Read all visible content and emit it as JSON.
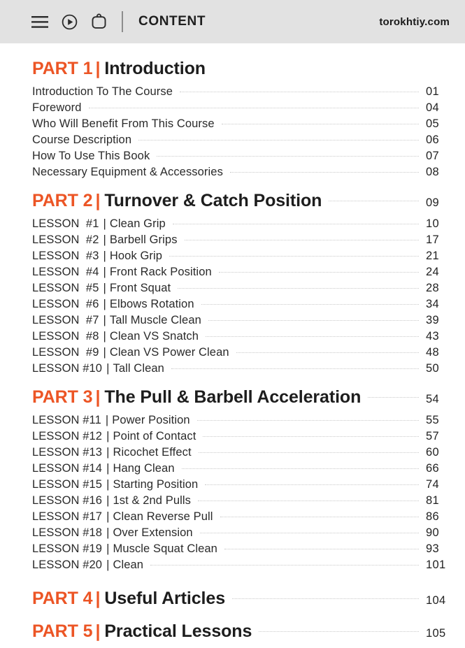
{
  "header": {
    "icons": [
      {
        "name": "hamburger-menu-icon",
        "label": "menu"
      },
      {
        "name": "play-circle-icon",
        "label": "play"
      },
      {
        "name": "bag-icon",
        "label": "bag"
      }
    ],
    "title": "CONTENT",
    "brand": "torokhtiy.com"
  },
  "colors": {
    "accent": "#ec5525",
    "header_bg": "#e2e2e2",
    "text": "#2a2a2a",
    "leader": "#c9c9c9"
  },
  "parts": [
    {
      "kw": "PART 1",
      "bar": "|",
      "title": "Introduction",
      "page": "",
      "entries": [
        {
          "label": "Introduction To The Course",
          "page": "01"
        },
        {
          "label": "Foreword",
          "page": "04"
        },
        {
          "label": "Who Will Benefit From This Course",
          "page": "05"
        },
        {
          "label": "Course Description",
          "page": "06"
        },
        {
          "label": "How To Use This Book",
          "page": "07"
        },
        {
          "label": "Necessary Equipment & Accessories",
          "page": "08"
        }
      ]
    },
    {
      "kw": "PART 2",
      "bar": "|",
      "title": "Turnover & Catch Position",
      "page": "09",
      "lessons": [
        {
          "word": "LESSON",
          "num": "#1",
          "pipe": "|",
          "title": "Clean Grip",
          "page": "10"
        },
        {
          "word": "LESSON",
          "num": "#2",
          "pipe": "|",
          "title": "Barbell Grips",
          "page": "17"
        },
        {
          "word": "LESSON",
          "num": "#3",
          "pipe": "|",
          "title": "Hook Grip",
          "page": "21"
        },
        {
          "word": "LESSON",
          "num": "#4",
          "pipe": "|",
          "title": "Front Rack Position",
          "page": "24"
        },
        {
          "word": "LESSON",
          "num": "#5",
          "pipe": "|",
          "title": "Front Squat",
          "page": "28"
        },
        {
          "word": "LESSON",
          "num": "#6",
          "pipe": "|",
          "title": "Elbows Rotation",
          "page": "34"
        },
        {
          "word": "LESSON",
          "num": "#7",
          "pipe": "|",
          "title": "Tall Muscle Clean",
          "page": "39"
        },
        {
          "word": "LESSON",
          "num": "#8",
          "pipe": "|",
          "title": "Clean VS Snatch",
          "page": "43"
        },
        {
          "word": "LESSON",
          "num": "#9",
          "pipe": "|",
          "title": "Clean VS Power Clean",
          "page": "48"
        },
        {
          "word": "LESSON",
          "num": "#10",
          "pipe": "|",
          "title": "Tall Clean",
          "page": "50"
        }
      ]
    },
    {
      "kw": "PART 3",
      "bar": "|",
      "title": "The Pull & Barbell Acceleration",
      "page": "54",
      "lessons": [
        {
          "word": "LESSON",
          "num": "#11",
          "pipe": "|",
          "title": "Power Position",
          "page": "55"
        },
        {
          "word": "LESSON",
          "num": "#12",
          "pipe": "|",
          "title": "Point of Contact",
          "page": "57"
        },
        {
          "word": "LESSON",
          "num": "#13",
          "pipe": "|",
          "title": "Ricochet Effect",
          "page": "60"
        },
        {
          "word": "LESSON",
          "num": "#14",
          "pipe": "|",
          "title": "Hang Clean",
          "page": "66"
        },
        {
          "word": "LESSON",
          "num": "#15",
          "pipe": "|",
          "title": "Starting Position",
          "page": "74"
        },
        {
          "word": "LESSON",
          "num": "#16",
          "pipe": "|",
          "title": "1st & 2nd Pulls",
          "page": "81"
        },
        {
          "word": "LESSON",
          "num": "#17",
          "pipe": "|",
          "title": "Clean Reverse Pull",
          "page": "86"
        },
        {
          "word": "LESSON",
          "num": "#18",
          "pipe": "|",
          "title": "Over Extension",
          "page": "90"
        },
        {
          "word": "LESSON",
          "num": "#19",
          "pipe": "|",
          "title": "Muscle Squat Clean",
          "page": "93"
        },
        {
          "word": "LESSON",
          "num": "#20",
          "pipe": "|",
          "title": "Clean",
          "page": "101"
        }
      ]
    },
    {
      "kw": "PART 4",
      "bar": "|",
      "title": "Useful Articles",
      "page": "104",
      "entries": []
    },
    {
      "kw": "PART 5",
      "bar": "|",
      "title": "Practical Lessons",
      "page": "105",
      "entries": []
    }
  ]
}
